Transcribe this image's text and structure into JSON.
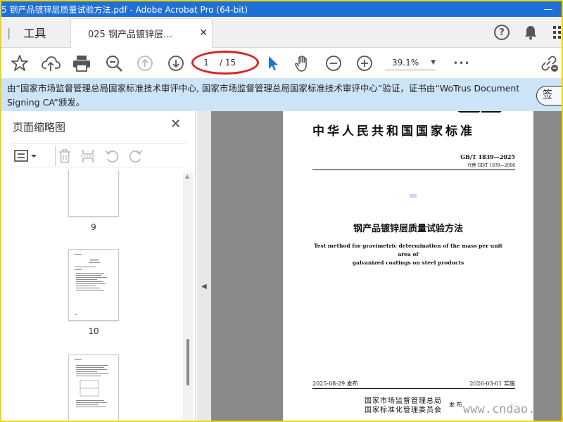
{
  "window": {
    "title": "5 钢产品镀锌层质量试验方法.pdf - Adobe Acrobat Pro (64-bit)",
    "minimize_glyph": "—",
    "close_glyph": "✕"
  },
  "watermarks": {
    "top": "道勤网",
    "bottom": "www.cndao."
  },
  "tabs": {
    "tools_label": "工具",
    "doc_tab_label": "025 钢产品镀锌层…",
    "doc_tab_close": "✕",
    "help_glyph": "?"
  },
  "toolbar": {
    "page_current": "1",
    "page_total": "/ 15",
    "zoom": "39.1%",
    "zoom_arrow": "▼",
    "more_glyph": "•••"
  },
  "notice": {
    "text": "由“国家市场监督管理总局国家标准技术审评中心, 国家市场监督管理总局国家标准技术审评中心”验证，证书由“WoTrus Document Signing CA”颁发。",
    "sign_button": "签"
  },
  "left_panel": {
    "title": "页面缩略图",
    "close_glyph": "✕",
    "thumbnails": [
      {
        "label": "9"
      },
      {
        "label": "10"
      }
    ]
  },
  "document": {
    "std_title": "中华人民共和国国家标准",
    "gb_number": "GB/T 1839—2025",
    "replaces": "代替 GB/T 1839—2008",
    "cn_name": "钢产品镀锌层质量试验方法",
    "en_name_line1": "Test method for gravimetric determination of the mass per unit area of",
    "en_name_line2": "galvanized coatings on steel products",
    "issue_date": "2025-08-29 发布",
    "impl_date": "2026-03-01 实施",
    "org_line1": "国家市场监督管理总局",
    "org_line2": "国家标准化管理委员会",
    "fabu": "发 布"
  },
  "colors": {
    "titlebar": "#1f6fd6",
    "frame_border": "#f2d600",
    "notice_bg": "#cde4f7",
    "annotation_red": "#e02020",
    "cursor_blue": "#1a73d9"
  }
}
